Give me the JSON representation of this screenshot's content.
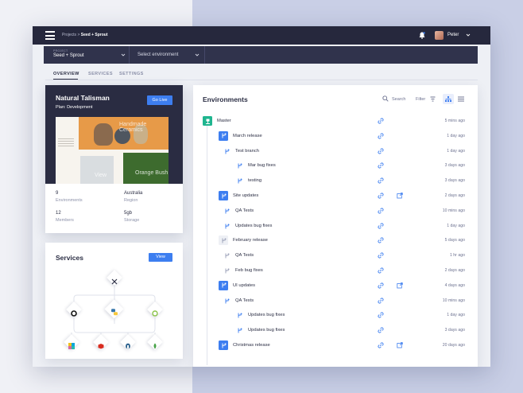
{
  "topbar": {
    "breadcrumb_root": "Projects",
    "breadcrumb_sep": ">",
    "breadcrumb_current": "Seed + Sprout",
    "user_name": "Peter"
  },
  "envbar": {
    "project_label": "PROJECT",
    "project_value": "Seed + Sprout",
    "environment_placeholder": "Select environment"
  },
  "tabs": [
    {
      "label": "OVERVIEW",
      "active": true
    },
    {
      "label": "SERVICES",
      "active": false
    },
    {
      "label": "SETTINGS",
      "active": false
    }
  ],
  "project_card": {
    "title": "Natural Talisman",
    "plan": "Plan: Development",
    "go_live_label": "Go Live",
    "preview": {
      "headline": "Handmade Ceramics",
      "left_caption": "View",
      "right_caption": "Orange Bush"
    },
    "stats": [
      {
        "value": "9",
        "label": "Environments"
      },
      {
        "value": "Australia",
        "label": "Region"
      },
      {
        "value": "12",
        "label": "Members"
      },
      {
        "value": "5gb",
        "label": "Storage"
      }
    ]
  },
  "services_card": {
    "title": "Services",
    "view_label": "View",
    "nodes": [
      "git-icon",
      "python-icon",
      "node-icon",
      "php-icon",
      "redis-icon",
      "mysql-icon",
      "mongodb-icon",
      "elastic-icon"
    ]
  },
  "environments": {
    "title": "Environments",
    "search_label": "Search",
    "filter_label": "Filter",
    "colors": {
      "master": "#1fb58f",
      "active": "#3d7ef0",
      "inactive": "#c2c6d6"
    },
    "rows": [
      {
        "name": "Master",
        "level": 0,
        "kind": "master",
        "time": "5 mins ago",
        "ext": false
      },
      {
        "name": "March release",
        "level": 1,
        "kind": "active",
        "time": "1 day ago",
        "ext": false
      },
      {
        "name": "Test branch",
        "level": 2,
        "kind": "active",
        "time": "1 day ago",
        "ext": false
      },
      {
        "name": "Mar bug fixes",
        "level": 3,
        "kind": "active",
        "time": "3 days ago",
        "ext": false
      },
      {
        "name": "testing",
        "level": 3,
        "kind": "active",
        "time": "3 days ago",
        "ext": false
      },
      {
        "name": "Site updates",
        "level": 1,
        "kind": "active",
        "time": "2 days ago",
        "ext": true
      },
      {
        "name": "QA Tests",
        "level": 2,
        "kind": "active",
        "time": "10 mins ago",
        "ext": false
      },
      {
        "name": "Updates bug fixes",
        "level": 2,
        "kind": "active",
        "time": "1 day ago",
        "ext": false
      },
      {
        "name": "February release",
        "level": 1,
        "kind": "inactive",
        "time": "5 days ago",
        "ext": false
      },
      {
        "name": "QA Tests",
        "level": 2,
        "kind": "inactive",
        "time": "1 hr ago",
        "ext": false
      },
      {
        "name": "Feb bug fixes",
        "level": 2,
        "kind": "inactive",
        "time": "2 days ago",
        "ext": false
      },
      {
        "name": "UI updates",
        "level": 1,
        "kind": "active",
        "time": "4 days ago",
        "ext": true
      },
      {
        "name": "QA Tests",
        "level": 2,
        "kind": "active",
        "time": "10 mins ago",
        "ext": false
      },
      {
        "name": "Updates bug fixes",
        "level": 3,
        "kind": "active",
        "time": "1 day ago",
        "ext": false
      },
      {
        "name": "Updates bug fixes",
        "level": 3,
        "kind": "active",
        "time": "3 days ago",
        "ext": false
      },
      {
        "name": "Christmas release",
        "level": 1,
        "kind": "active",
        "time": "20 days ago",
        "ext": true
      }
    ]
  }
}
